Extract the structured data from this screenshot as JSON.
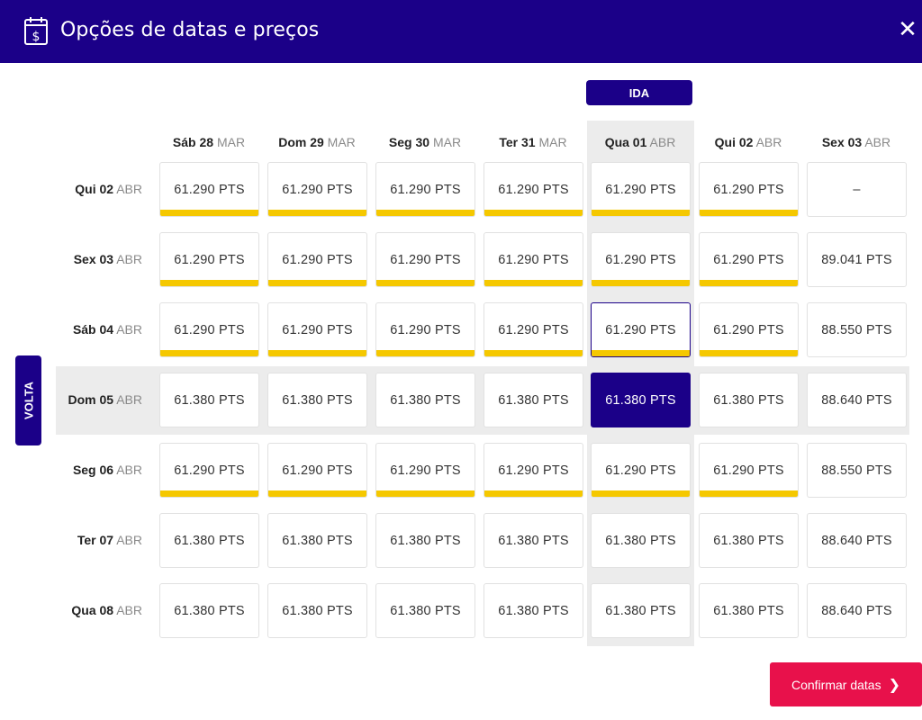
{
  "header": {
    "title": "Opções de datas e preços",
    "close_label": "✕"
  },
  "ida_label": "IDA",
  "volta_label": "VOLTA",
  "columns": [
    {
      "day": "Sáb 28",
      "month": "MAR"
    },
    {
      "day": "Dom 29",
      "month": "MAR"
    },
    {
      "day": "Seg 30",
      "month": "MAR"
    },
    {
      "day": "Ter 31",
      "month": "MAR"
    },
    {
      "day": "Qua 01",
      "month": "ABR"
    },
    {
      "day": "Qui 02",
      "month": "ABR"
    },
    {
      "day": "Sex 03",
      "month": "ABR"
    }
  ],
  "rows": [
    {
      "day": "Qui 02",
      "month": "ABR",
      "cells": [
        "61.290 PTS",
        "61.290 PTS",
        "61.290 PTS",
        "61.290 PTS",
        "61.290 PTS",
        "61.290 PTS",
        "–"
      ],
      "lowest": [
        true,
        true,
        true,
        true,
        true,
        true,
        false
      ]
    },
    {
      "day": "Sex 03",
      "month": "ABR",
      "cells": [
        "61.290 PTS",
        "61.290 PTS",
        "61.290 PTS",
        "61.290 PTS",
        "61.290 PTS",
        "61.290 PTS",
        "89.041 PTS"
      ],
      "lowest": [
        true,
        true,
        true,
        true,
        true,
        true,
        false
      ]
    },
    {
      "day": "Sáb 04",
      "month": "ABR",
      "cells": [
        "61.290 PTS",
        "61.290 PTS",
        "61.290 PTS",
        "61.290 PTS",
        "61.290 PTS",
        "61.290 PTS",
        "88.550 PTS"
      ],
      "lowest": [
        true,
        true,
        true,
        true,
        true,
        true,
        false
      ]
    },
    {
      "day": "Dom 05",
      "month": "ABR",
      "cells": [
        "61.380 PTS",
        "61.380 PTS",
        "61.380 PTS",
        "61.380 PTS",
        "61.380 PTS",
        "61.380 PTS",
        "88.640 PTS"
      ],
      "lowest": [
        false,
        false,
        false,
        false,
        false,
        false,
        false
      ]
    },
    {
      "day": "Seg 06",
      "month": "ABR",
      "cells": [
        "61.290 PTS",
        "61.290 PTS",
        "61.290 PTS",
        "61.290 PTS",
        "61.290 PTS",
        "61.290 PTS",
        "88.550 PTS"
      ],
      "lowest": [
        true,
        true,
        true,
        true,
        true,
        true,
        false
      ]
    },
    {
      "day": "Ter 07",
      "month": "ABR",
      "cells": [
        "61.380 PTS",
        "61.380 PTS",
        "61.380 PTS",
        "61.380 PTS",
        "61.380 PTS",
        "61.380 PTS",
        "88.640 PTS"
      ],
      "lowest": [
        false,
        false,
        false,
        false,
        false,
        false,
        false
      ]
    },
    {
      "day": "Qua 08",
      "month": "ABR",
      "cells": [
        "61.380 PTS",
        "61.380 PTS",
        "61.380 PTS",
        "61.380 PTS",
        "61.380 PTS",
        "61.380 PTS",
        "88.640 PTS"
      ],
      "lowest": [
        false,
        false,
        false,
        false,
        false,
        false,
        false
      ]
    }
  ],
  "selected_outbound_column": 4,
  "selected_return_row": 3,
  "hovered_cell": {
    "row": 2,
    "col": 4
  },
  "confirm_label": "Confirmar datas",
  "confirm_icon": "chevron-right-icon",
  "colors": {
    "brand": "#1b0088",
    "lowest_price_bar": "#f5c800",
    "confirm": "#e8114b",
    "highlight": "#ececec"
  }
}
